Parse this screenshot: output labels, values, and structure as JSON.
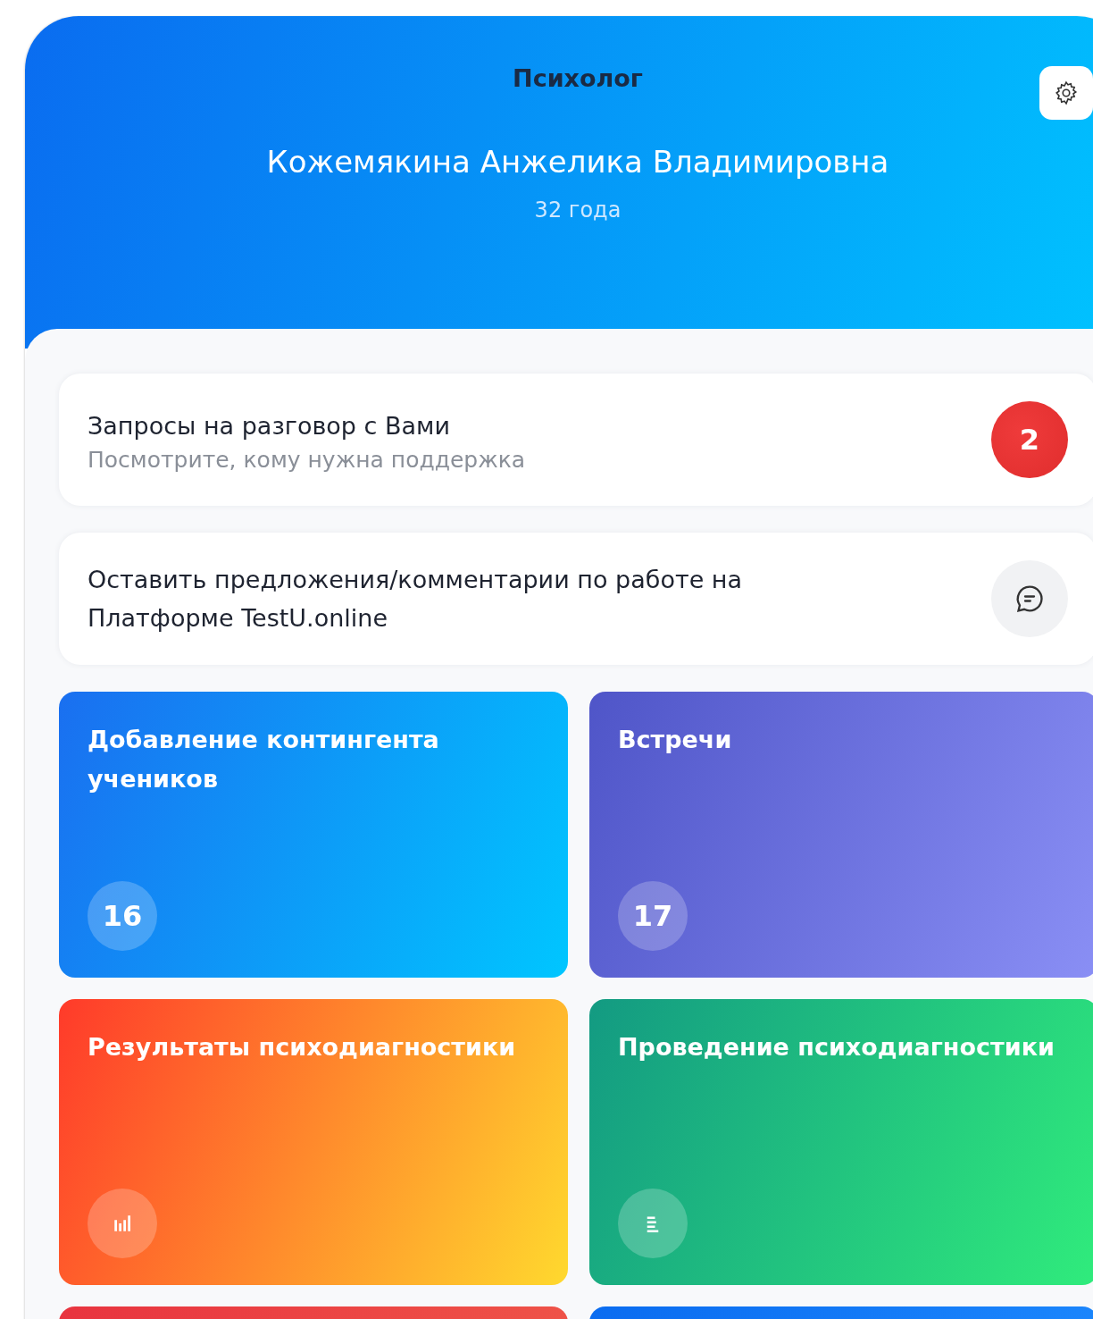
{
  "header": {
    "role": "Психолог",
    "name": "Кожемякина Анжелика Владимировна",
    "age": "32 года"
  },
  "cards": [
    {
      "kind": "badge",
      "title": "Запросы на разговор с Вами",
      "subtitle": "Посмотрите, кому нужна поддержка",
      "badge": "2"
    },
    {
      "kind": "comment",
      "title": "Оставить предложения/комментарии по работе на Платформе TestU.online"
    }
  ],
  "tiles": [
    {
      "kind": "count",
      "title": "Добавление контингента учеников",
      "count": "16",
      "color": "#1a6ff0"
    },
    {
      "kind": "count",
      "title": "Встречи",
      "count": "17",
      "color": "#4f55c8"
    },
    {
      "kind": "chart",
      "title": "Результаты психодиагностики",
      "color": "#ff3a2a"
    },
    {
      "kind": "list",
      "title": "Проведение психодиагностики",
      "color": "#139a82"
    },
    {
      "kind": "none",
      "color": "#e8343f"
    },
    {
      "kind": "none",
      "color": "#0a6cf0"
    }
  ]
}
